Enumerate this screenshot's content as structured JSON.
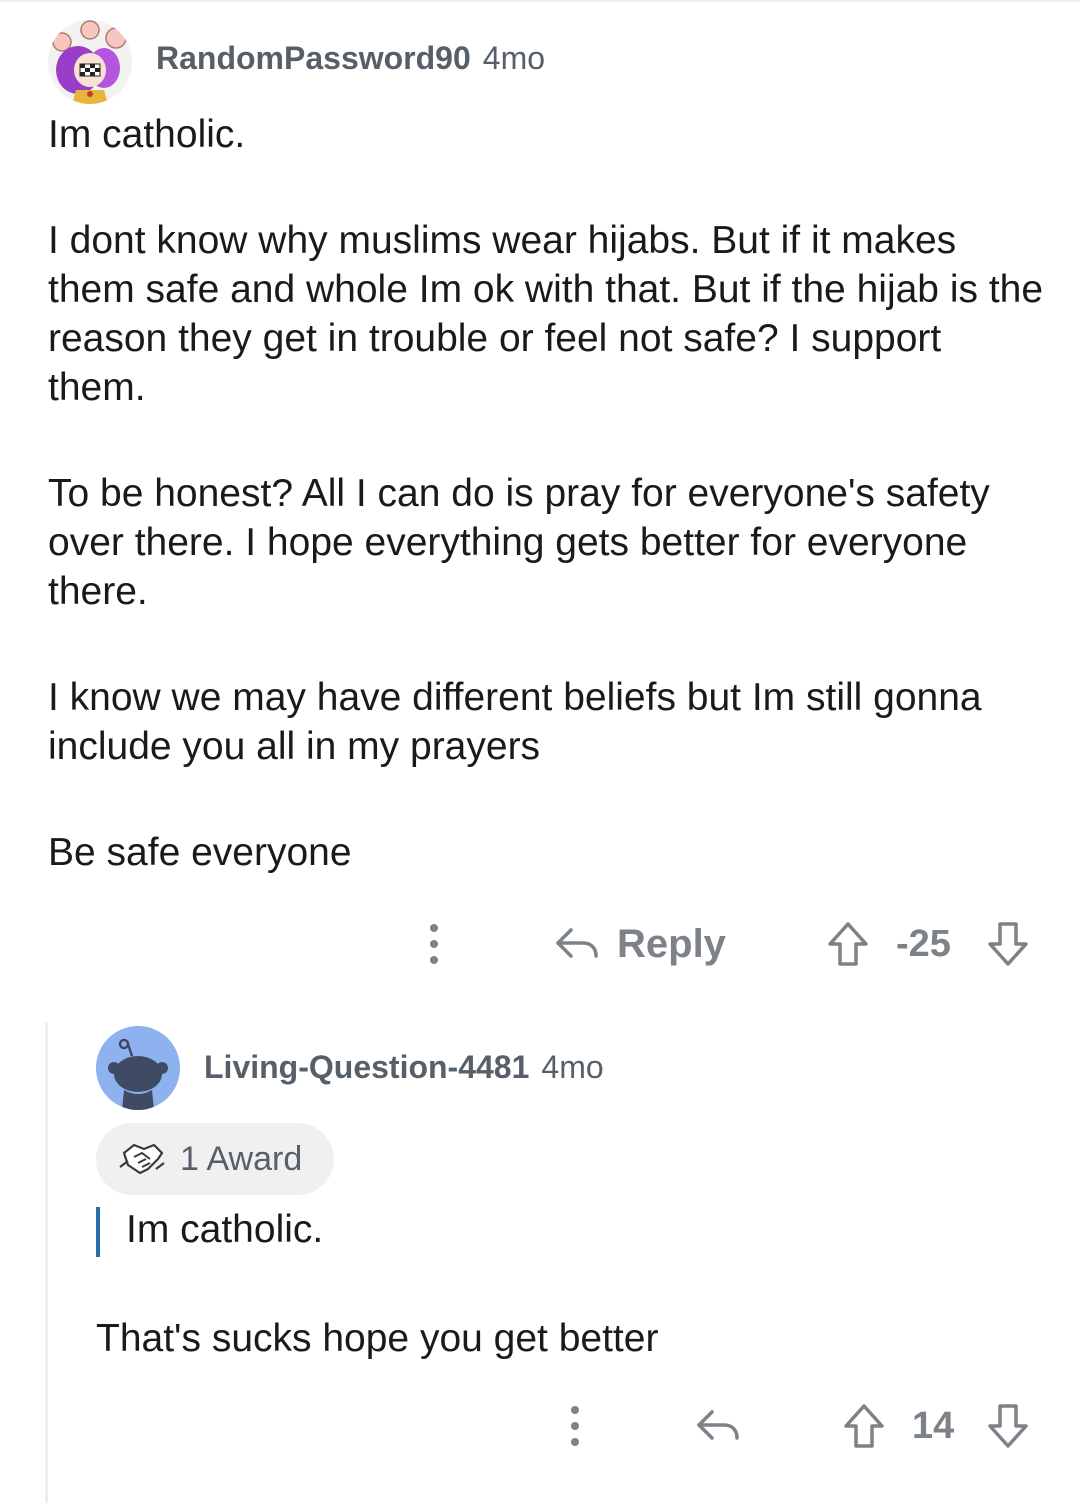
{
  "comment": {
    "username": "RandomPassword90",
    "age": "4mo",
    "paragraphs": [
      "Im catholic.",
      "I dont know why muslims wear hijabs. But if it makes them safe and whole Im ok with that. But if the hijab is the reason they get in trouble or feel not safe? I support them.",
      "To be honest? All I can do is pray for everyone's safety over there. I hope everything gets better for everyone there.",
      "I know we may have different beliefs but Im still gonna include you all in my prayers",
      "Be safe everyone"
    ],
    "actions": {
      "reply_label": "Reply",
      "score": "-25"
    }
  },
  "reply": {
    "username": "Living-Question-4481",
    "age": "4mo",
    "award_label": "1 Award",
    "quote": "Im catholic.",
    "text": "That's sucks hope you get better",
    "actions": {
      "score": "14"
    }
  },
  "icons": {
    "more": "more-vertical-icon",
    "reply": "reply-arrow-icon",
    "upvote": "upvote-arrow-icon",
    "downvote": "downvote-arrow-icon",
    "award": "handshake-award-icon"
  },
  "colors": {
    "meta_text": "#576068",
    "action_gray": "#7c8287",
    "quote_bar": "#2d6ea8",
    "snoo_avatar_bg": "#8db2ef"
  }
}
